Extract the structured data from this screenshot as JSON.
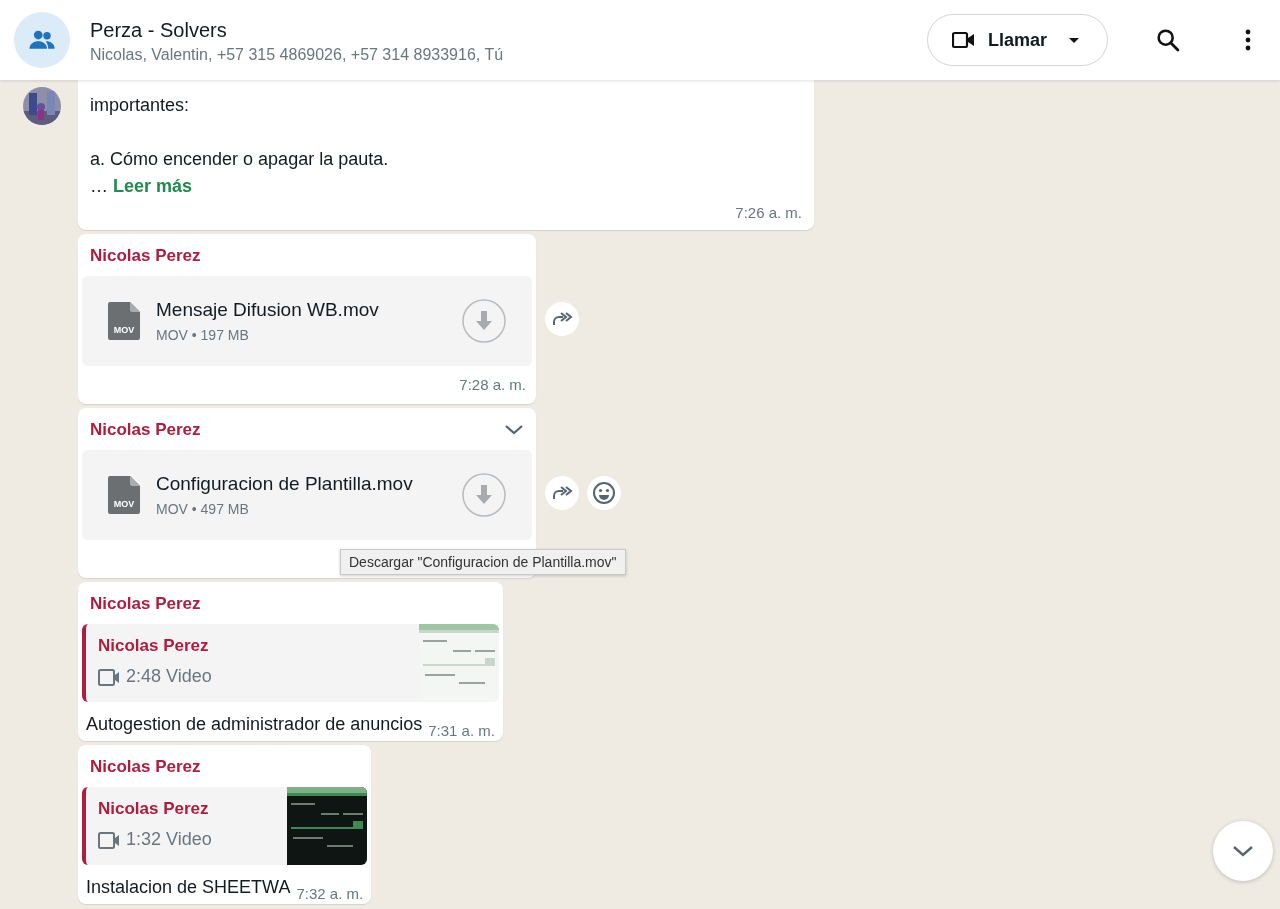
{
  "header": {
    "title": "Perza - Solvers",
    "subtitle": "Nicolas, Valentin, +57 315 4869026, +57 314 8933916, Tú",
    "call_button": {
      "label": "Llamar"
    }
  },
  "messages": [
    {
      "kind": "text",
      "show_avatar": true,
      "paragraphs": [
        "importantes:",
        "a. Cómo encender o apagar la pauta."
      ],
      "ellipsis": "…",
      "read_more": "Leer más",
      "time": "7:26 a. m.",
      "show_forward": false,
      "show_react": false,
      "show_menu": false
    },
    {
      "kind": "document",
      "show_avatar": false,
      "sender": "Nicolas Perez",
      "file_type": "MOV",
      "file_name": "Mensaje Difusion WB.mov",
      "file_meta": "MOV • 197 MB",
      "time": "7:28 a. m.",
      "show_forward": true,
      "show_react": false,
      "show_menu": false
    },
    {
      "kind": "document",
      "show_avatar": false,
      "sender": "Nicolas Perez",
      "file_type": "MOV",
      "file_name": "Configuracion de Plantilla.mov",
      "file_meta": "MOV • 497 MB",
      "show_forward": true,
      "show_react": true,
      "show_menu": true,
      "tooltip": "Descargar \"Configuracion de Plantilla.mov\""
    },
    {
      "kind": "video",
      "show_avatar": false,
      "sender": "Nicolas Perez",
      "quote_sender": "Nicolas Perez",
      "quote_text": "2:48 Video",
      "caption": "Autogestion de administrador de anuncios",
      "time": "7:31 a. m.",
      "show_forward": false,
      "show_react": false,
      "show_menu": false
    },
    {
      "kind": "video",
      "show_avatar": false,
      "sender": "Nicolas Perez",
      "quote_sender": "Nicolas Perez",
      "quote_text": "1:32 Video",
      "caption": "Instalacion de SHEETWA",
      "time": "7:32 a. m.",
      "show_forward": false,
      "show_react": false,
      "show_menu": false
    }
  ]
}
